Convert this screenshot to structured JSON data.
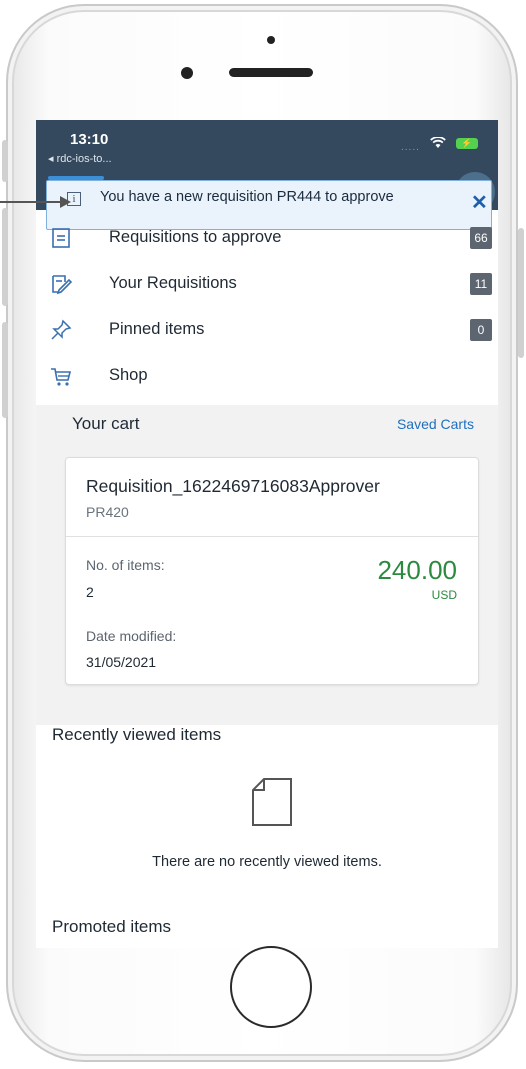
{
  "status_bar": {
    "time": "13:10",
    "back_app": "◂ rdc-ios-to...",
    "signal": "....."
  },
  "notification": {
    "icon": "info-icon",
    "message": "You have a new requisition PR444 to approve",
    "close": "✕"
  },
  "menu": {
    "items": [
      {
        "icon": "document-list-icon",
        "label": "Requisitions to approve",
        "badge": "66"
      },
      {
        "icon": "edit-document-icon",
        "label": "Your Requisitions",
        "badge": "11"
      },
      {
        "icon": "pin-icon",
        "label": "Pinned items",
        "badge": "0"
      },
      {
        "icon": "cart-icon",
        "label": "Shop",
        "badge": ""
      }
    ]
  },
  "cart": {
    "title": "Your cart",
    "saved_carts_link": "Saved Carts",
    "card": {
      "name": "Requisition_1622469716083Approver",
      "id": "PR420",
      "items_label": "No. of items:",
      "items_value": "2",
      "amount": "240.00",
      "currency": "USD",
      "date_label": "Date modified:",
      "date_value": "31/05/2021"
    }
  },
  "recently_viewed": {
    "title": "Recently viewed items",
    "empty_message": "There are no recently viewed items."
  },
  "promoted": {
    "title": "Promoted items"
  },
  "colors": {
    "header": "#35495e",
    "link": "#1d6fc1",
    "amount": "#2b8a3e",
    "notification_bg": "#eaf3fc"
  }
}
